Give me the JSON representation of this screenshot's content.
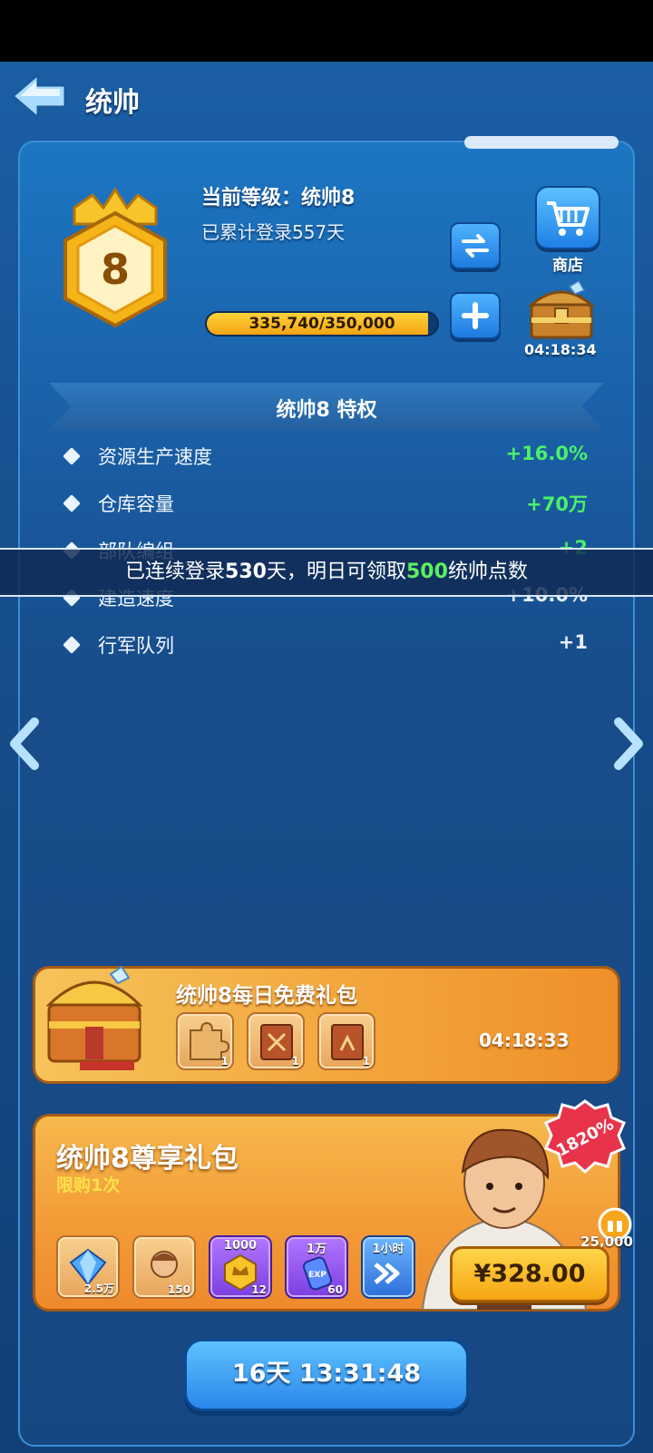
{
  "header": {
    "title": "统帅"
  },
  "level_card": {
    "badge_number": "8",
    "current_level": "当前等级：统帅8",
    "login_total": "已累计登录557天",
    "xp_text": "335,740/350,000",
    "xp_progress": 0.959,
    "shop_label": "商店",
    "chest_timer": "04:18:34"
  },
  "privileges": {
    "title": "统帅8 特权",
    "items": [
      {
        "name": "资源生产速度",
        "value": "+16.0%"
      },
      {
        "name": "仓库容量",
        "value": "+70万"
      },
      {
        "name": "部队编组",
        "value": "+2"
      },
      {
        "name": "建造速度",
        "value": "+10.0%"
      },
      {
        "name": "行军队列",
        "value": "+1"
      }
    ]
  },
  "toast": {
    "part1": "已连续登录",
    "days": "530",
    "part2": "天，明日可领取",
    "points": "500",
    "part3": "统帅点数"
  },
  "daily_pack": {
    "title": "统帅8每日免费礼包",
    "timer": "04:18:33",
    "items": [
      {
        "icon": "puzzle-piece-icon",
        "count": "1"
      },
      {
        "icon": "book-swords-icon",
        "count": "1"
      },
      {
        "icon": "book-flag-icon",
        "count": "1"
      }
    ]
  },
  "vip_pack": {
    "title": "统帅8尊享礼包",
    "limit": "限购1次",
    "percent": "1820%",
    "token_value": "25,000",
    "price": "¥328.00",
    "items": [
      {
        "icon": "diamond-icon",
        "top": "",
        "count": "2.5万"
      },
      {
        "icon": "hero-fragment-icon",
        "top": "",
        "count": "150"
      },
      {
        "icon": "gold-crown-token-icon",
        "top": "1000",
        "count": "12"
      },
      {
        "icon": "exp-potion-icon",
        "top": "1万",
        "count": "60"
      },
      {
        "icon": "speedup-icon",
        "top": "1小时",
        "count": ""
      }
    ]
  },
  "footer": {
    "timer": "16天 13:31:48"
  },
  "colors": {
    "accent_green": "#4cf06a",
    "gold": "#f5a511",
    "panel_blue": "#1a5fa6"
  }
}
